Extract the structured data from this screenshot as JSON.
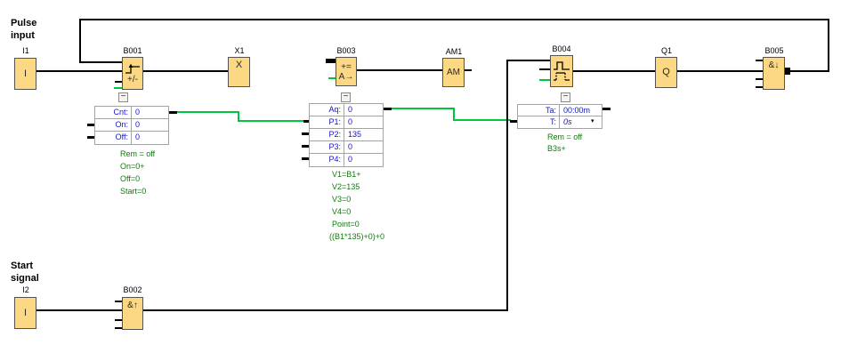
{
  "colors": {
    "block_fill": "#FCD884",
    "block_border": "#55534B",
    "wire_black": "#000000",
    "wire_green": "#00C53F",
    "text_green": "#0E7A0E",
    "text_blue": "#1414C8",
    "box_border": "#A3A3A3"
  },
  "annotations": {
    "pulse_input": "Pulse\ninput",
    "start_signal": "Start\nsignal"
  },
  "blocks": {
    "i1": {
      "label": "I1",
      "symbol": "I"
    },
    "b001": {
      "label": "B001",
      "symbol": "+/-"
    },
    "x1": {
      "label": "X1",
      "symbol": "X"
    },
    "b003": {
      "label": "B003",
      "symbol_top": "+=",
      "symbol_bottom": "A→"
    },
    "am1": {
      "label": "AM1",
      "symbol": "AM"
    },
    "b004": {
      "label": "B004"
    },
    "q1": {
      "label": "Q1",
      "symbol": "Q"
    },
    "b005": {
      "label": "B005",
      "symbol": "&↓"
    },
    "i2": {
      "label": "I2",
      "symbol": "I"
    },
    "b002": {
      "label": "B002",
      "symbol": "&↑"
    }
  },
  "param_boxes": {
    "b001": {
      "rows": [
        {
          "label": "Cnt:",
          "value": "0"
        },
        {
          "label": "On:",
          "value": "0"
        },
        {
          "label": "Off:",
          "value": "0"
        }
      ],
      "notes": [
        "Rem = off",
        "On=0+",
        "Off=0",
        "Start=0"
      ]
    },
    "b003": {
      "rows": [
        {
          "label": "Aq:",
          "value": "0"
        },
        {
          "label": "P1:",
          "value": "0"
        },
        {
          "label": "P2:",
          "value": "135"
        },
        {
          "label": "P3:",
          "value": "0"
        },
        {
          "label": "P4:",
          "value": "0"
        }
      ],
      "notes": [
        "V1=B1+",
        "V2=135",
        "V3=0",
        "V4=0",
        "Point=0",
        "((B1*135)+0)+0"
      ]
    },
    "b004": {
      "rows": [
        {
          "label": "Ta:",
          "value": "00:00m"
        },
        {
          "label": "T:",
          "value": "0s"
        }
      ],
      "notes": [
        "Rem = off",
        "B3s+"
      ]
    }
  },
  "icons": {
    "collapse": "−",
    "dropdown": "▾"
  }
}
